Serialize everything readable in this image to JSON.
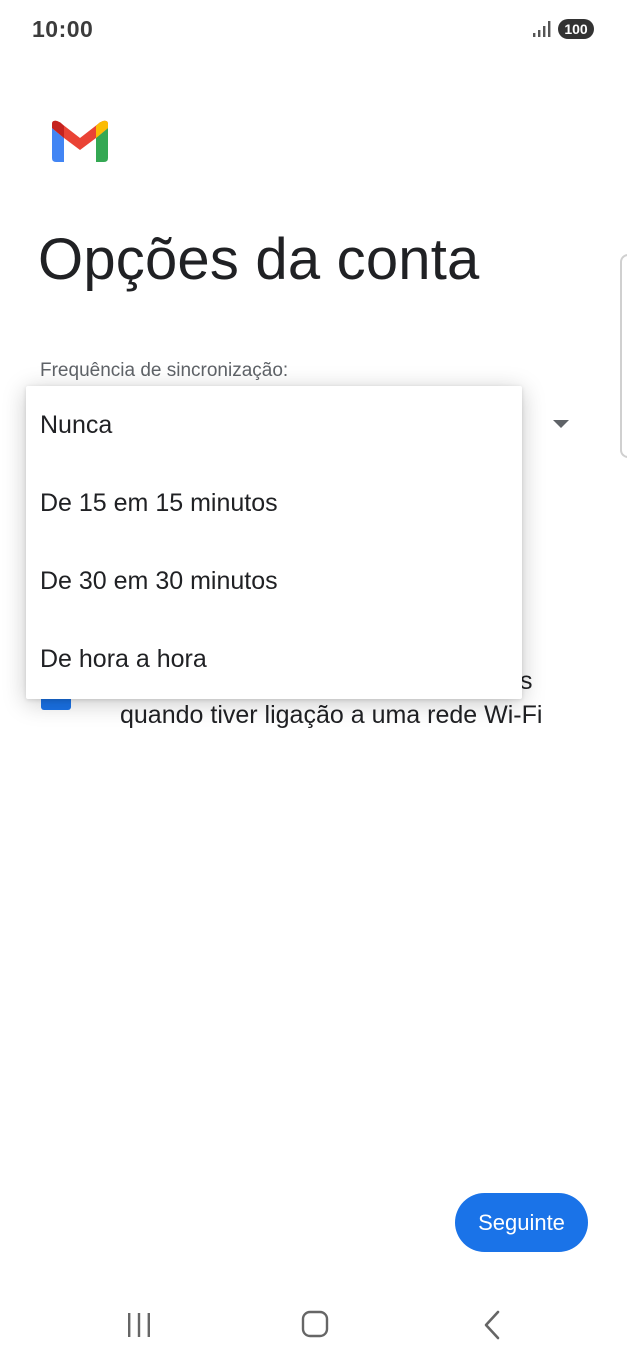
{
  "status_bar": {
    "time": "10:00",
    "battery": "100"
  },
  "page": {
    "title": "Opções da conta",
    "sync_label": "Frequência de sincronização:"
  },
  "options": {
    "option1_visible_text": "os",
    "option2_visible_tail": "s",
    "option2_line2": "quando tiver ligação a uma rede Wi-Fi"
  },
  "dropdown": {
    "items": [
      {
        "label": "Nunca"
      },
      {
        "label": "De 15 em 15 minutos"
      },
      {
        "label": "De 30 em 30 minutos"
      },
      {
        "label": "De hora a hora"
      }
    ]
  },
  "buttons": {
    "next_label": "Seguinte"
  },
  "colors": {
    "accent": "#1a73e8",
    "text": "#202124",
    "muted": "#5f6368"
  },
  "icons": {
    "logo": "gmail-logo",
    "signal": "signal-icon",
    "recents": "recents-icon",
    "home": "home-icon",
    "back": "back-icon"
  }
}
